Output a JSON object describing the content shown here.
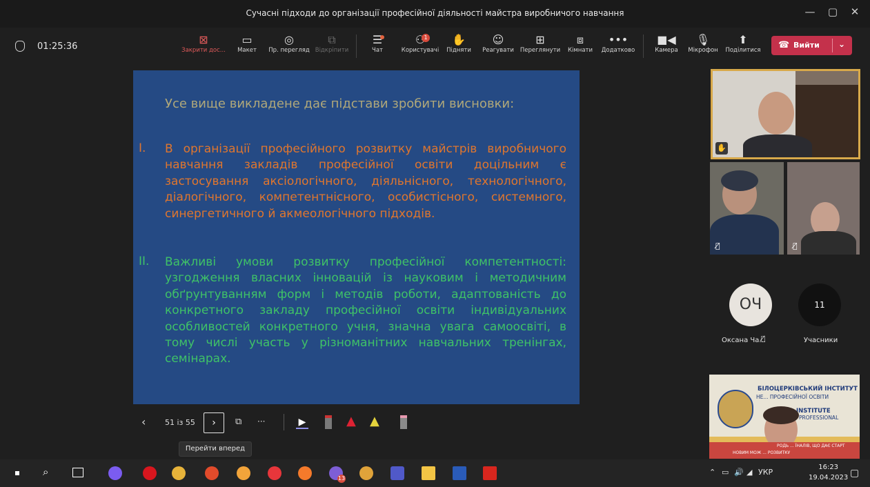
{
  "window": {
    "title": "Сучасні підходи до організації професійної діяльності майстра виробничого навчання",
    "controls": {
      "minimize": "—",
      "maximize": "▢",
      "close": "✕"
    }
  },
  "meeting": {
    "timer": "01:25:36",
    "toolbar": {
      "close_share": "Закрити дос...",
      "layout": "Макет",
      "presenter_view": "Пр. перегляд",
      "pop_out": "Відкріпити",
      "chat": "Чат",
      "people": "Користувачі",
      "people_badge": "1",
      "raise": "Підняти",
      "react": "Реагувати",
      "view": "Переглянути",
      "rooms": "Кімнати",
      "more": "Додатково",
      "camera": "Камера",
      "mic": "Мікрофон",
      "share": "Поділитися",
      "leave": "Вийти"
    }
  },
  "slide": {
    "heading": "Усе вище викладене дає підстави зробити висновки:",
    "items": [
      {
        "num": "I.",
        "text": "В організації професійного розвитку майстрів виробничого навчання закладів професійної освіти доцільним є застосування аксіологічного, діяльнісного, технологічного, діалогічного, компетентнісного, особистісного, системного, синергетичного й акмеологічного підходів."
      },
      {
        "num": "II.",
        "text": "Важливі умови розвитку професійної компетентності: узгодження власних інновацій із науковим і методичним обґрунтуванням форм і методів роботи, адаптованість до конкретного закладу професійної освіти індивідуальних особливостей конкретного учня, значна увага самоосвіті, в тому числі участь у різноманітних навчальних тренінгах, семінарах."
      }
    ]
  },
  "slide_nav": {
    "counter": "51 із 55",
    "tooltip": "Перейти вперед"
  },
  "participants": {
    "avatar_initials": "ОЧ",
    "avatar_name": "Оксана Ча...",
    "count": "11",
    "count_label": "Учасники"
  },
  "banner": {
    "line1": "БІЛОЦЕРКІВСЬКИЙ ІНСТИТУТ",
    "line2": "НЕ... ПРОФЕСІЙНОЇ ОСВІТИ",
    "line3": "INSTITUTE",
    "line4": "PROFESSIONAL",
    "footer1": "РОДЬ ... ЇНАЛІВ, ЩО ДАЄ СТАРТ",
    "footer2": "НОВИМ МОЖ ... РОЗВИТКУ"
  },
  "taskbar": {
    "tray_lang": "УКР",
    "time": "16:23",
    "date": "19.04.2023",
    "viber_badge": "13"
  },
  "colors": {
    "slide_bg": "#254a84",
    "orange_text": "#e0762e",
    "green_text": "#3fc267",
    "leave_red": "#c4314b",
    "speaker_border": "#d8a94a"
  }
}
